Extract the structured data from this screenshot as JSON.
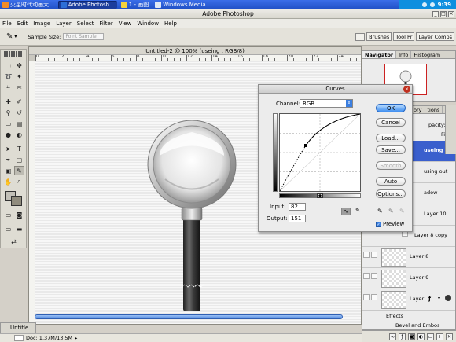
{
  "taskbar": {
    "tabs": [
      {
        "label": "火星时代动画大...",
        "active": false,
        "icon_color": "#f28c28"
      },
      {
        "label": "Adobe Photosh...",
        "active": true,
        "icon_color": "#2d6fd6"
      },
      {
        "label": "1 - 画图",
        "active": false,
        "icon_color": "#f5d23d"
      },
      {
        "label": "Windows Media...",
        "active": false,
        "icon_color": "#dfe8f5"
      }
    ],
    "clock": "9:39"
  },
  "window": {
    "title": "Adobe Photoshop"
  },
  "menu": [
    "File",
    "Edit",
    "Image",
    "Layer",
    "Select",
    "Filter",
    "View",
    "Window",
    "Help"
  ],
  "options_bar": {
    "sample_size_label": "Sample Size:",
    "sample_size_value": "Point Sample"
  },
  "panel_wells": [
    "Brushes",
    "Tool Pr",
    "Layer Comps"
  ],
  "document": {
    "title": "Untitled-2 @ 100% (useing , RGB/8)",
    "ruler_labels": [
      "0",
      "2",
      "4",
      "6",
      "8",
      "10",
      "12",
      "14",
      "16",
      "18",
      "20",
      "22",
      "24"
    ],
    "minimized_label": "Untitle...",
    "status": "Doc: 1.37M/13.5M"
  },
  "curves": {
    "title": "Curves",
    "channel_label": "Channel:",
    "channel_value": "RGB",
    "input_label": "Input:",
    "input_value": "82",
    "output_label": "Output:",
    "output_value": "151",
    "buttons": {
      "ok": "OK",
      "cancel": "Cancel",
      "load": "Load...",
      "save": "Save...",
      "smooth": "Smooth",
      "auto": "Auto",
      "options": "Options..."
    },
    "preview_label": "Preview",
    "preview_checked": true
  },
  "navigator": {
    "tabs": [
      "Navigator",
      "Info",
      "Histogram"
    ]
  },
  "layers_palette": {
    "tabs_partial": [
      "ory",
      "tions"
    ],
    "opacity_label": "pacity:",
    "fill_label": "Fill:",
    "layers": [
      {
        "name": "useing",
        "selected": true
      },
      {
        "name": "using out",
        "selected": false
      },
      {
        "name": "adow",
        "selected": false
      },
      {
        "name": "Layer 10",
        "selected": false
      },
      {
        "name": "Layer 8 copy",
        "selected": false
      },
      {
        "name": "Layer 8",
        "selected": false
      },
      {
        "name": "Layer 9",
        "selected": false
      },
      {
        "name": "Layer...",
        "selected": false
      }
    ],
    "effects_label": "Effects",
    "bevel_label": "Bevel and Embos"
  }
}
